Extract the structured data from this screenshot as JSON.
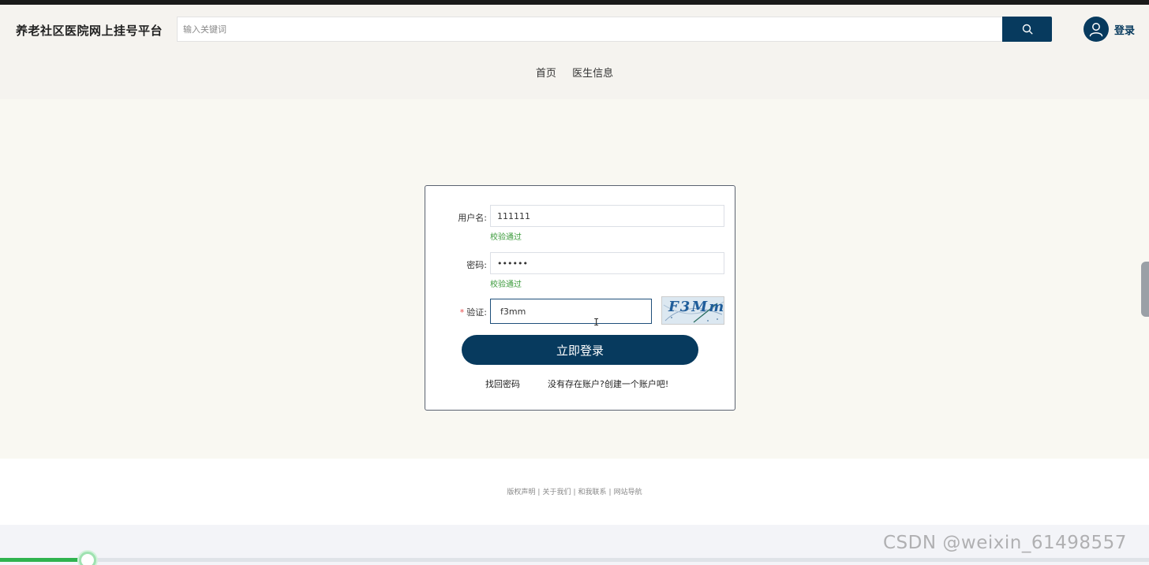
{
  "header": {
    "site_title": "养老社区医院网上挂号平台",
    "search_placeholder": "输入关键词",
    "login_label": "登录"
  },
  "nav": {
    "items": [
      {
        "label": "首页"
      },
      {
        "label": "医生信息"
      }
    ]
  },
  "login_form": {
    "username_label": "用户名:",
    "username_value": "111111",
    "username_tip": "校验通过",
    "password_label": "密码:",
    "password_value": "••••••",
    "password_tip": "校验通过",
    "captcha_required_mark": "*",
    "captcha_label": "验证:",
    "captcha_value": "f3mm",
    "captcha_image_text": "F3Mm",
    "submit_label": "立即登录",
    "forgot_label": "找回密码",
    "register_label": "没有存在账户?创建一个账户吧!"
  },
  "footer": {
    "links": [
      {
        "label": "版权声明"
      },
      {
        "label": "关于我们"
      },
      {
        "label": "和我联系"
      },
      {
        "label": "网站导航"
      }
    ],
    "separator": "|"
  },
  "player": {
    "progress_fraction": 0.076
  },
  "watermark": "CSDN @weixin_61498557",
  "colors": {
    "accent": "#073a5e",
    "success": "#3a9a3a",
    "required": "#e84c4c",
    "progress": "#2fb34f"
  },
  "icons": {
    "search": "search-icon",
    "avatar": "user-icon"
  }
}
